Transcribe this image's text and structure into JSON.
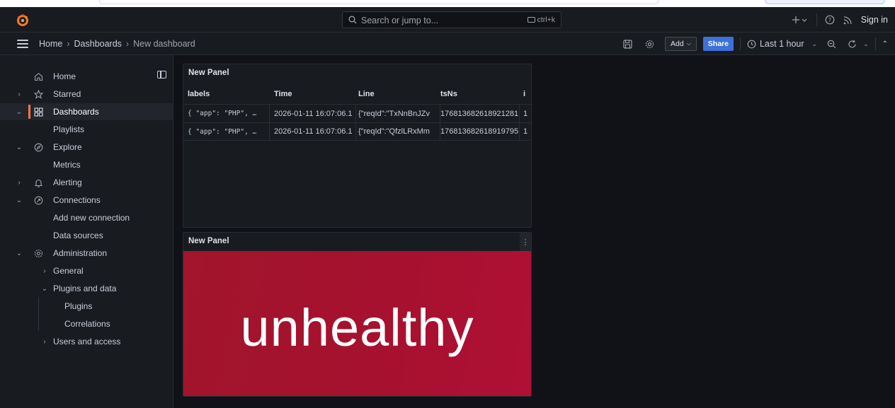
{
  "topbar": {
    "search_placeholder": "Search or jump to...",
    "search_shortcut": "ctrl+k",
    "sign_in": "Sign in"
  },
  "breadcrumb": {
    "items": [
      "Home",
      "Dashboards",
      "New dashboard"
    ],
    "separator": "›"
  },
  "toolbar": {
    "add_label": "Add",
    "share_label": "Share",
    "time_range": "Last 1 hour"
  },
  "sidebar": {
    "items": [
      {
        "label": "Home",
        "icon": "home-icon"
      },
      {
        "label": "Starred",
        "icon": "star-icon"
      },
      {
        "label": "Dashboards",
        "icon": "apps-icon"
      },
      {
        "label": "Playlists"
      },
      {
        "label": "Explore",
        "icon": "compass-icon"
      },
      {
        "label": "Metrics"
      },
      {
        "label": "Alerting",
        "icon": "bell-icon"
      },
      {
        "label": "Connections",
        "icon": "link-icon"
      },
      {
        "label": "Add new connection"
      },
      {
        "label": "Data sources"
      },
      {
        "label": "Administration",
        "icon": "cog-icon"
      },
      {
        "label": "General"
      },
      {
        "label": "Plugins and data"
      },
      {
        "label": "Plugins"
      },
      {
        "label": "Correlations"
      },
      {
        "label": "Users and access"
      }
    ]
  },
  "panels": {
    "table_panel": {
      "title": "New Panel",
      "columns": [
        "labels",
        "Time",
        "Line",
        "tsNs",
        "i"
      ],
      "rows": [
        [
          "{ \"app\": \"PHP\", …",
          "2026-01-11 16:07:06.1",
          "{\"reqId\":\"TxNnBnJZv",
          "176813682618921281",
          "1"
        ],
        [
          "{ \"app\": \"PHP\", …",
          "2026-01-11 16:07:06.1",
          "{\"reqId\":\"QfzlLRxMm",
          "176813682618919795",
          "1"
        ]
      ]
    },
    "stat_panel": {
      "title": "New Panel",
      "value": "unhealthy",
      "color": "#a5112e"
    }
  },
  "colors": {
    "accent": "#ff7a3d",
    "share_button": "#3d71d9",
    "background": "#111217"
  }
}
